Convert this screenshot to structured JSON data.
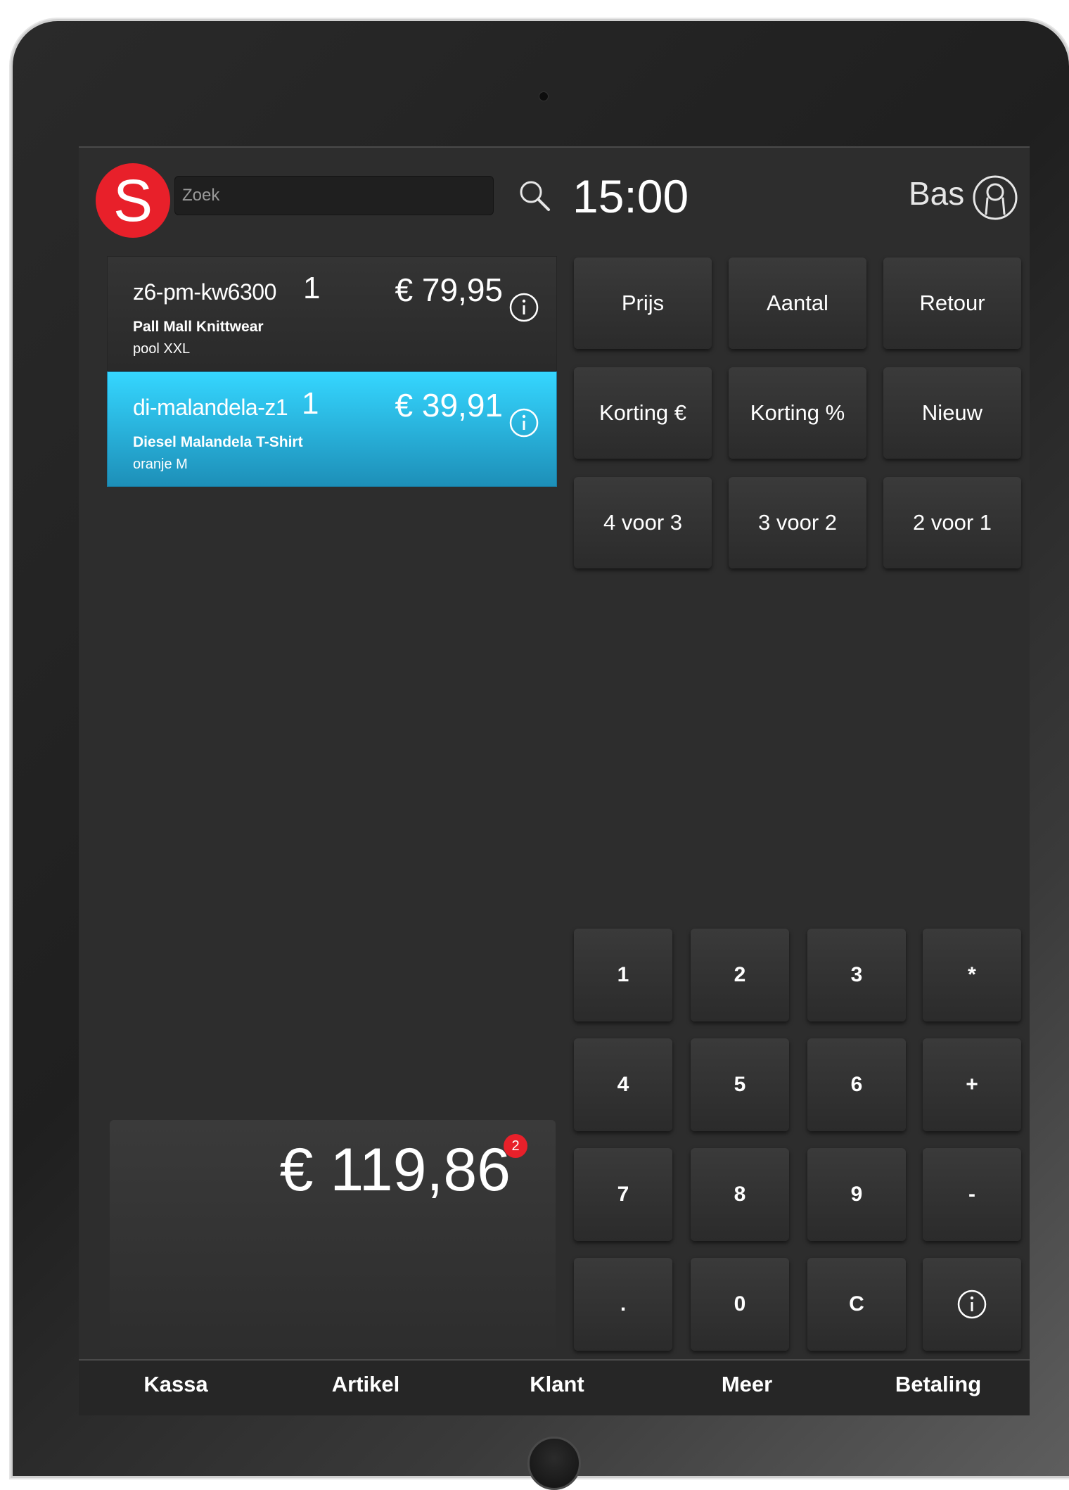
{
  "header": {
    "logo_letter": "S",
    "search_placeholder": "Zoek",
    "time": "15:00",
    "user_name": "Bas"
  },
  "cart": {
    "items": [
      {
        "sku": "z6-pm-kw6300",
        "qty": "1",
        "price": "€ 79,95",
        "name": "Pall Mall Knittwear",
        "variant": "pool XXL",
        "selected": false
      },
      {
        "sku": "di-malandela-z1",
        "qty": "1",
        "price": "€ 39,91",
        "name": "Diesel Malandela T-Shirt",
        "variant": "oranje M",
        "selected": true
      }
    ]
  },
  "functions": [
    "Prijs",
    "Aantal",
    "Retour",
    "Korting €",
    "Korting %",
    "Nieuw",
    "4 voor 3",
    "3 voor 2",
    "2 voor 1"
  ],
  "keypad": [
    "1",
    "2",
    "3",
    "*",
    "4",
    "5",
    "6",
    "+",
    "7",
    "8",
    "9",
    "-",
    ".",
    "0",
    "C",
    "info"
  ],
  "total": {
    "amount": "€ 119,86",
    "item_count": "2"
  },
  "nav": [
    "Kassa",
    "Artikel",
    "Klant",
    "Meer",
    "Betaling"
  ],
  "colors": {
    "brand_red": "#e8202a",
    "selected_item": "#2bb8e6",
    "background": "#2d2d2d"
  },
  "icons": {
    "search": "search-icon",
    "user": "user-icon",
    "info": "info-icon"
  }
}
